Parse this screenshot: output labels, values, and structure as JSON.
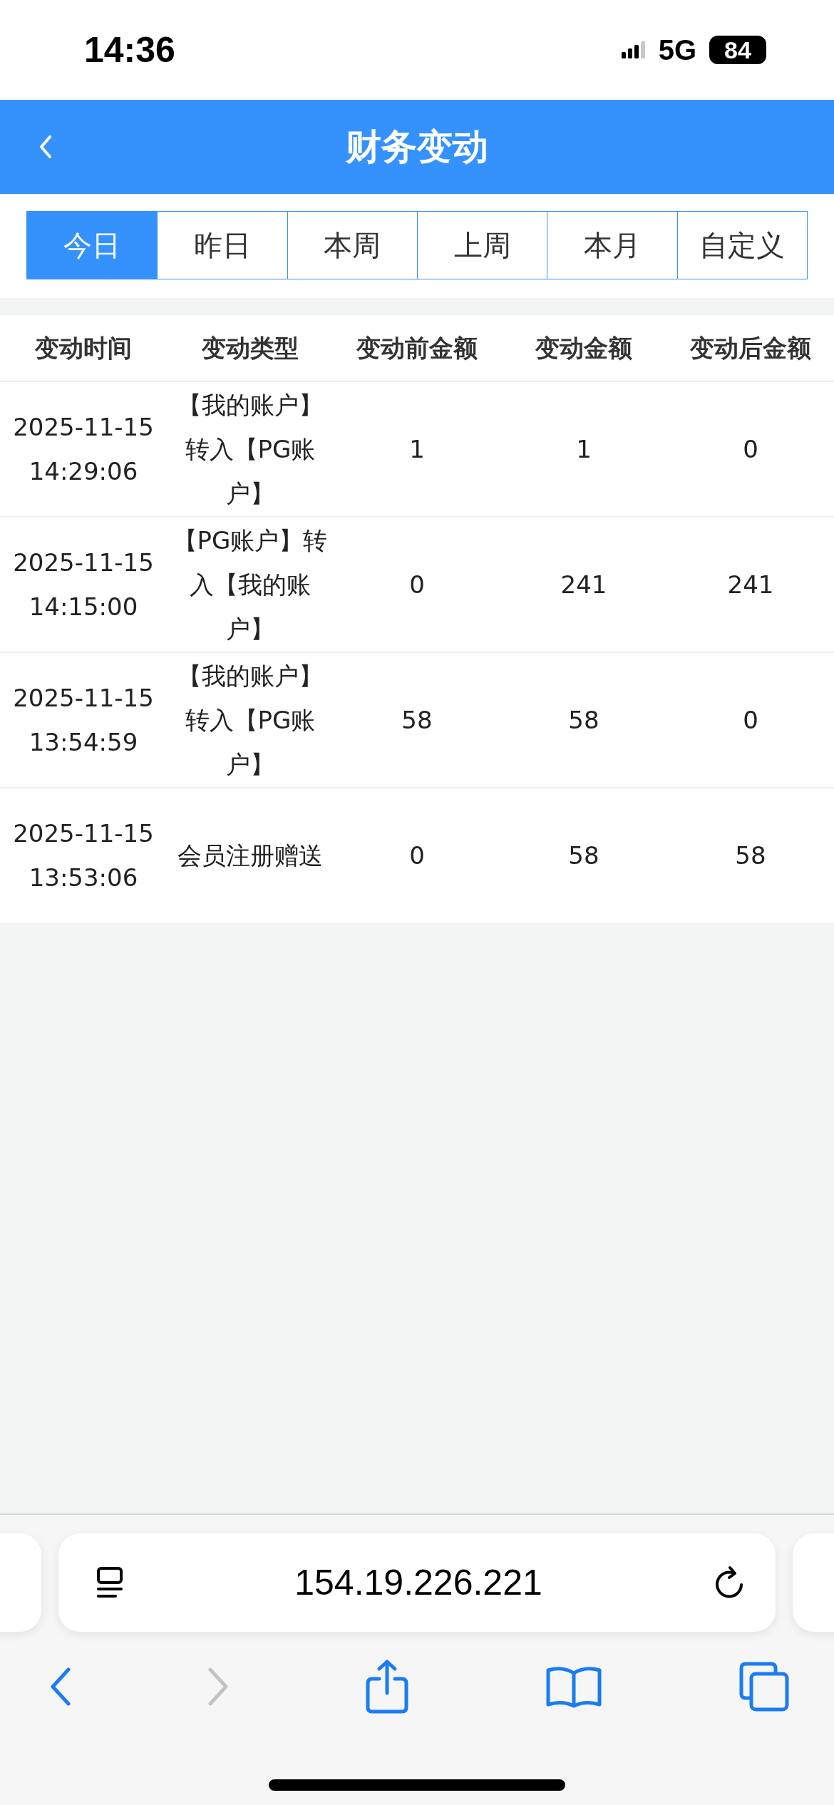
{
  "status_bar": {
    "time": "14:36",
    "network": "5G",
    "battery": "84"
  },
  "header": {
    "title": "财务变动"
  },
  "tabs": [
    {
      "label": "今日",
      "selected": true
    },
    {
      "label": "昨日",
      "selected": false
    },
    {
      "label": "本周",
      "selected": false
    },
    {
      "label": "上周",
      "selected": false
    },
    {
      "label": "本月",
      "selected": false
    },
    {
      "label": "自定义",
      "selected": false
    }
  ],
  "table": {
    "columns": [
      "变动时间",
      "变动类型",
      "变动前金额",
      "变动金额",
      "变动后金额"
    ],
    "rows": [
      [
        "2025-11-15 14:29:06",
        "【我的账户】转入【PG账户】",
        "1",
        "1",
        "0"
      ],
      [
        "2025-11-15 14:15:00",
        "【PG账户】转入【我的账户】",
        "0",
        "241",
        "241"
      ],
      [
        "2025-11-15 13:54:59",
        "【我的账户】转入【PG账户】",
        "58",
        "58",
        "0"
      ],
      [
        "2025-11-15 13:53:06",
        "会员注册赠送",
        "0",
        "58",
        "58"
      ]
    ]
  },
  "browser": {
    "address": "154.19.226.221",
    "forward_disabled": true
  }
}
